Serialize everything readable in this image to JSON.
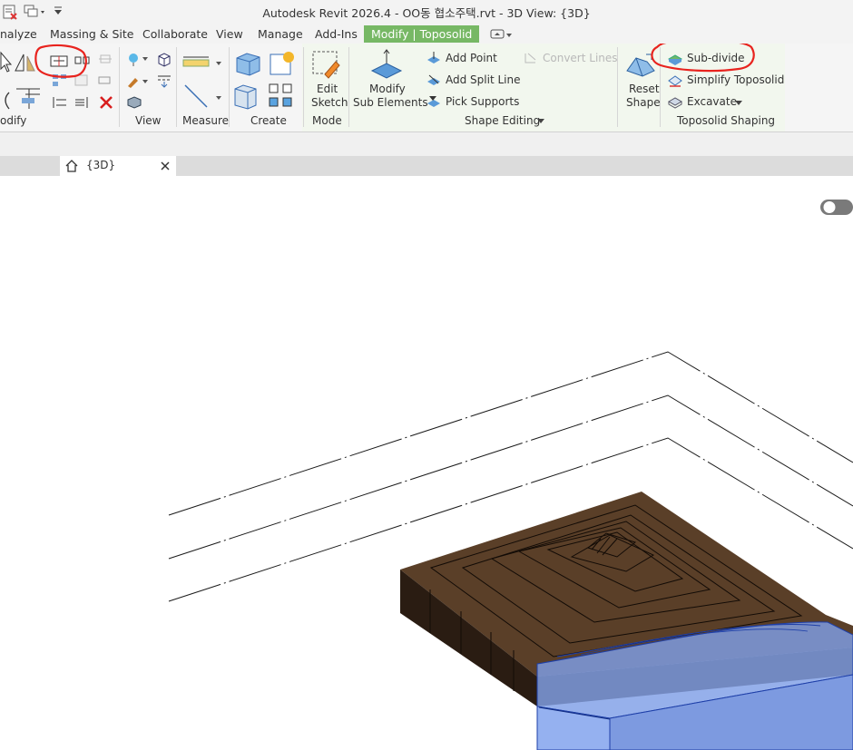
{
  "window": {
    "title": "Autodesk Revit 2026.4 - OO동 협소주택.rvt - 3D View: {3D}"
  },
  "tabs": [
    {
      "label": "nalyze"
    },
    {
      "label": "Massing & Site"
    },
    {
      "label": "Collaborate"
    },
    {
      "label": "View"
    },
    {
      "label": "Manage"
    },
    {
      "label": "Add-Ins"
    },
    {
      "label": "Modify | Toposolid"
    }
  ],
  "ribbon": {
    "panels": {
      "modify": "odify",
      "view": "View",
      "measure": "Measure",
      "create": "Create",
      "mode": "Mode",
      "shape_editing": "Shape Editing",
      "toposolid_shaping": "Toposolid Shaping"
    },
    "buttons": {
      "edit_sketch_1": "Edit",
      "edit_sketch_2": "Sketch",
      "modify_sub_1": "Modify",
      "modify_sub_2": "Sub Elements",
      "add_point": "Add Point",
      "add_split_line": "Add Split Line",
      "pick_supports": "Pick Supports",
      "convert_lines": "Convert Lines",
      "reset_shape_1": "Reset",
      "reset_shape_2": "Shape",
      "sub_divide": "Sub-divide",
      "simplify_toposolid": "Simplify Toposolid",
      "excavate": "Excavate"
    }
  },
  "view_tab": {
    "label": "{3D}"
  },
  "colors": {
    "tab_active": "#77b865",
    "annotation_red": "#e8231e",
    "terrain_top": "#5a3f28",
    "terrain_side": "#2a1c12",
    "subdivision": "#7f9fe6"
  }
}
